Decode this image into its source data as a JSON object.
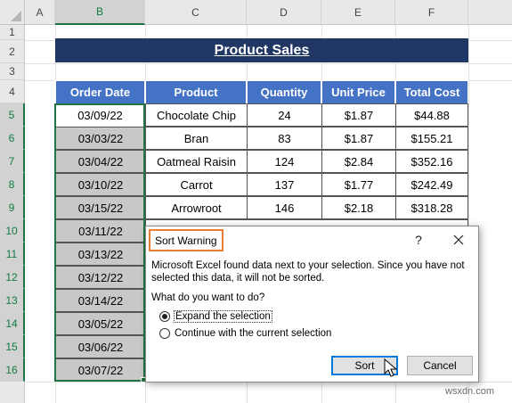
{
  "grid": {
    "columns": [
      "A",
      "B",
      "C",
      "D",
      "E",
      "F"
    ],
    "rows": [
      "1",
      "2",
      "3",
      "4",
      "5",
      "6",
      "7",
      "8",
      "9",
      "10",
      "11",
      "12",
      "13",
      "14",
      "15",
      "16"
    ],
    "selected_column": "B"
  },
  "title": "Product Sales",
  "table": {
    "headers": [
      "Order Date",
      "Product",
      "Quantity",
      "Unit Price",
      "Total Cost"
    ],
    "rows": [
      [
        "03/09/22",
        "Chocolate Chip",
        "24",
        "$1.87",
        "$44.88"
      ],
      [
        "03/03/22",
        "Bran",
        "83",
        "$1.87",
        "$155.21"
      ],
      [
        "03/04/22",
        "Oatmeal Raisin",
        "124",
        "$2.84",
        "$352.16"
      ],
      [
        "03/10/22",
        "Carrot",
        "137",
        "$1.77",
        "$242.49"
      ],
      [
        "03/15/22",
        "Arrowroot",
        "146",
        "$2.18",
        "$318.28"
      ]
    ],
    "hidden_dates": [
      "03/11/22",
      "03/13/22",
      "03/12/22",
      "03/14/22",
      "03/05/22",
      "03/06/22",
      "03/07/22"
    ]
  },
  "dialog": {
    "title": "Sort Warning",
    "help": "?",
    "close_icon": "close-icon",
    "message": "Microsoft Excel found data next to your selection.  Since you have not selected this data, it will not be sorted.",
    "question": "What do you want to do?",
    "option_expand": "Expand the selection",
    "option_continue": "Continue with the current selection",
    "sort_button": "Sort",
    "cancel_button": "Cancel",
    "selected_option": "expand"
  },
  "watermark": "wsxdn.com",
  "colors": {
    "header_blue": "#4472c4",
    "title_navy": "#203764",
    "excel_green": "#217346",
    "highlight_orange": "#ed7d31"
  }
}
